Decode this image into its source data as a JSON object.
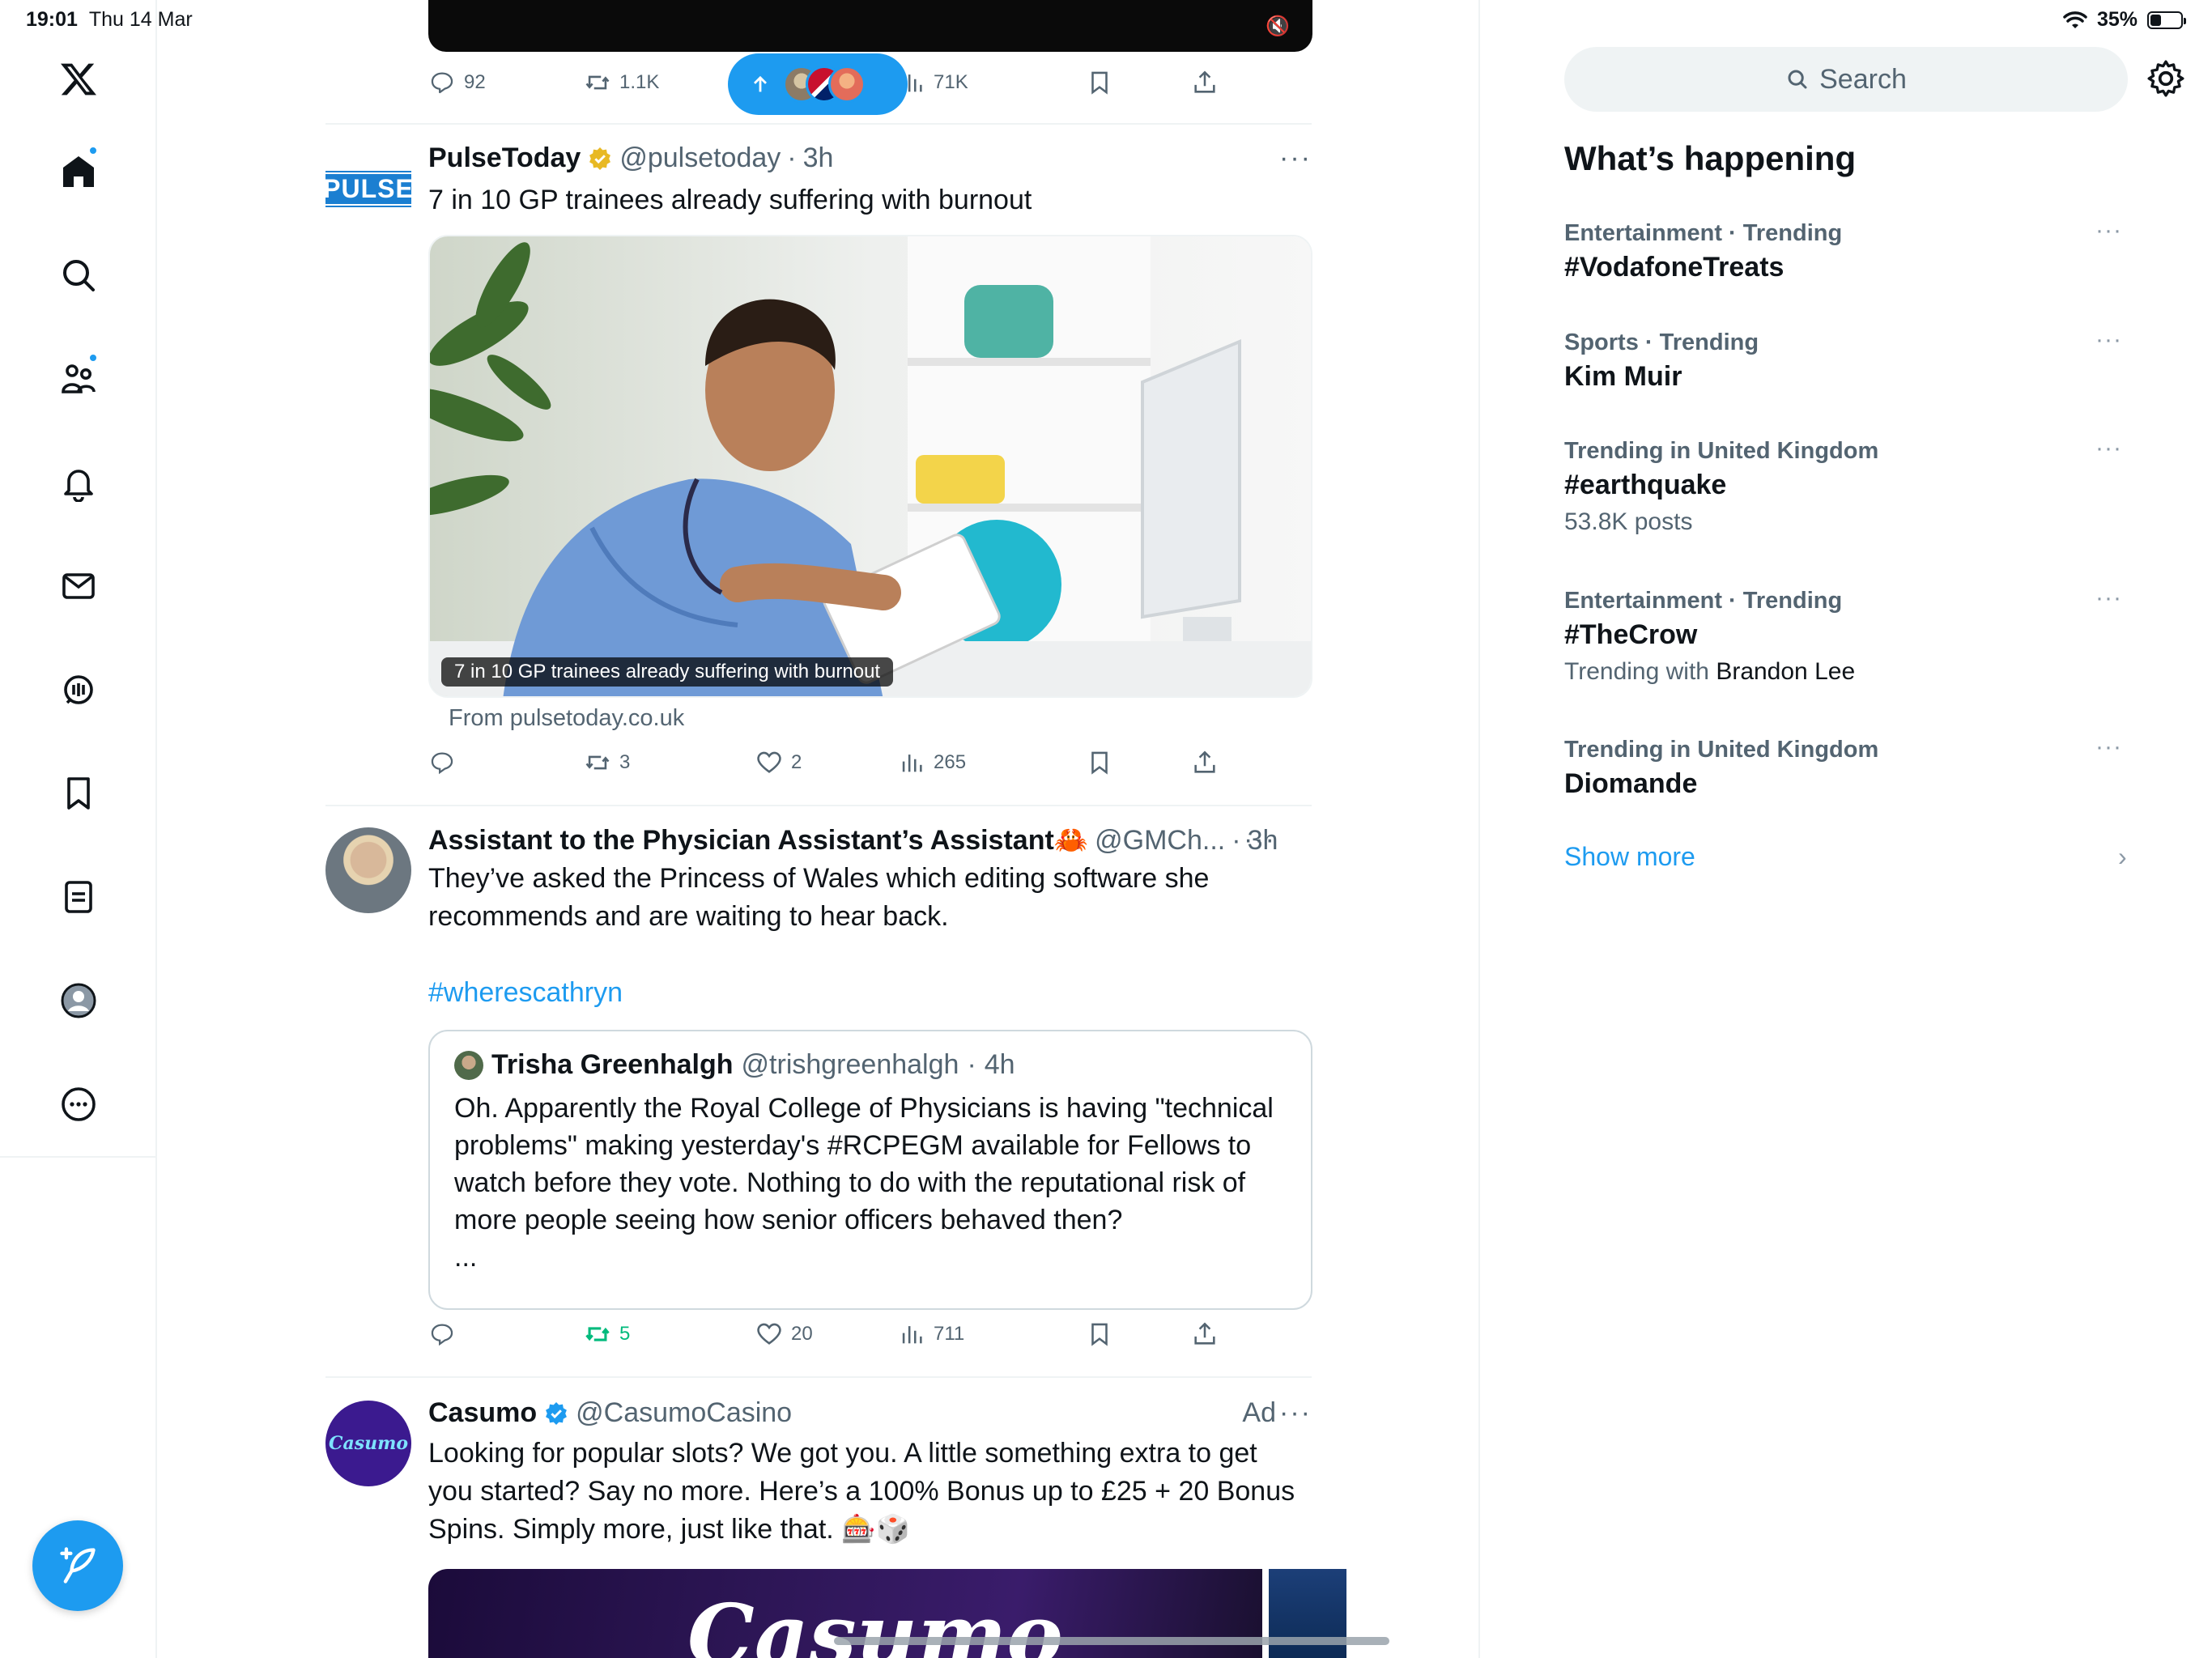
{
  "status_bar": {
    "time": "19:01",
    "date": "Thu 14 Mar",
    "battery": "35%",
    "battery_fill": 0.35
  },
  "nav": {
    "items": [
      {
        "name": "x-logo",
        "label": "X"
      },
      {
        "name": "home",
        "label": "Home"
      },
      {
        "name": "explore",
        "label": "Explore"
      },
      {
        "name": "communities",
        "label": "Communities"
      },
      {
        "name": "notifications",
        "label": "Notifications"
      },
      {
        "name": "messages",
        "label": "Messages"
      },
      {
        "name": "spaces",
        "label": "Spaces"
      },
      {
        "name": "bookmarks",
        "label": "Bookmarks"
      },
      {
        "name": "lists",
        "label": "Lists"
      },
      {
        "name": "profile",
        "label": "Profile"
      },
      {
        "name": "more",
        "label": "More"
      }
    ]
  },
  "new_posts_pill": {
    "icon": "arrow-up-icon"
  },
  "tweets": [
    {
      "id": "video-tweet",
      "actions": {
        "replies": "92",
        "reposts": "1.1K",
        "views": "71K"
      }
    },
    {
      "id": "pulse-tweet",
      "name": "PulseToday",
      "handle": "@pulsetoday",
      "time": "3h",
      "avatar_text": "PULSE",
      "text": "7 in 10 GP trainees already suffering with burnout",
      "media_caption": "7 in 10 GP trainees already suffering with burnout",
      "link_source": "From pulsetoday.co.uk",
      "actions": {
        "replies": "",
        "reposts": "3",
        "likes": "2",
        "views": "265"
      }
    },
    {
      "id": "gmch-tweet",
      "name": "Assistant to the Physician Assistant’s Assistant",
      "emoji": "🦀",
      "handle": "@GMCh...",
      "time": "3h",
      "text_line1": "They’ve asked the Princess of Wales which editing software she",
      "text_line2": "recommends and are waiting to hear back.",
      "hashtag": "#wherescathryn",
      "quote": {
        "name": "Trisha Greenhalgh",
        "handle": "@trishgreenhalgh",
        "time": "4h",
        "line1": "Oh. Apparently the Royal College of Physicians is having \"technical",
        "line2": "problems\" making yesterday's #RCPEGM available for Fellows to",
        "line3": "watch before they vote. Nothing to do with the reputational risk of",
        "line4": "more people seeing how senior officers behaved then?",
        "line5": "..."
      },
      "actions": {
        "replies": "",
        "reposts": "5",
        "likes": "20",
        "views": "711"
      }
    },
    {
      "id": "casumo-tweet",
      "name": "Casumo",
      "handle": "@CasumoCasino",
      "ad_label": "Ad",
      "avatar_text": "Casumo",
      "line1": "Looking for popular slots? We got you. A little something extra to get",
      "line2": "you started? Say no more. Here’s a 100% Bonus up to £25 + 20 Bonus",
      "line3": "Spins. Simply more, just like that. 🎰🎲",
      "banner_text": "Casumo"
    }
  ],
  "right": {
    "search_placeholder": "Search",
    "title": "What’s happening",
    "trends": [
      {
        "meta": "Entertainment · Trending",
        "name": "#VodafoneTreats",
        "extra": ""
      },
      {
        "meta": "Sports · Trending",
        "name": "Kim Muir",
        "extra": ""
      },
      {
        "meta": "Trending in United Kingdom",
        "name": "#earthquake",
        "extra": "53.8K posts"
      },
      {
        "meta": "Entertainment · Trending",
        "name": "#TheCrow",
        "extra_prefix": "Trending with ",
        "extra_name": "Brandon Lee"
      },
      {
        "meta": "Trending in United Kingdom",
        "name": "Diomande",
        "extra": ""
      }
    ],
    "more_label": "···",
    "show_more": "Show more"
  },
  "colors": {
    "accent": "#1d9bf0",
    "text": "#0f1419",
    "muted": "#536471",
    "repost_green": "#00ba7c",
    "verified_gold": "#e8b923"
  }
}
